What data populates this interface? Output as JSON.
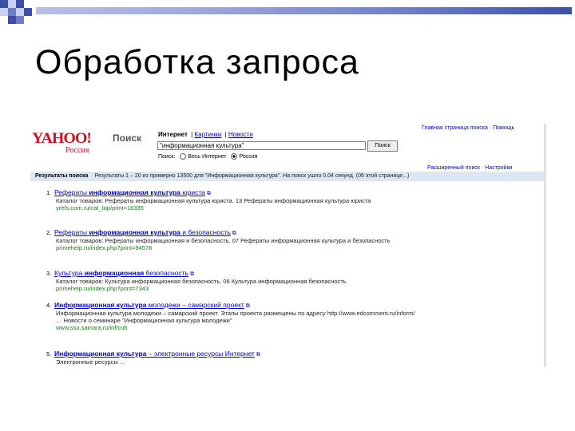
{
  "slide": {
    "title": "Обработка запроса"
  },
  "decor": {
    "accent_dark": "#3e4fa8",
    "accent_light": "#b7bfe6"
  },
  "yahoo": {
    "logo": "YAHOO!",
    "logo_sub": "Россия",
    "search_word": "Поиск",
    "tabs": {
      "internet": "Интернет",
      "images": "Картинки",
      "news": "Новости"
    },
    "query": "\"информационная культура\"",
    "search_button": "Поиск",
    "scope_label": "Поиск:",
    "scope_all": "Весь Интернет",
    "scope_russia": "Россия",
    "top_links": "Главная страница поиска · Помощь",
    "settings_links": "Расширенный поиск · Настройки",
    "results_label": "Результаты поиска",
    "results_stats": "Результаты 1 – 20 из примерно 13500 для \"Информационная культура\". На поиск ушло 0.04 секунд. (06 этой странице...)",
    "results": [
      {
        "num": "1.",
        "title_a": "Рефераты ",
        "title_b": "информационная культура",
        "title_c": " юриста",
        "snippet": "Каталог товаров: Рефераты информационная культура юриста. 13 Рефераты информационная культура юриста",
        "url": "yrefs.com.ru/cat_top/print=16335"
      },
      {
        "num": "2.",
        "title_a": "Рефераты ",
        "title_b": "информационная культура",
        "title_c": " и безопасность",
        "snippet": "Каталог товаров: Рефераты информационная и безопасность. 07 Рефераты информационная культура и безопасность",
        "url": "primehelp.ru/index.php?print=94578"
      },
      {
        "num": "3.",
        "title_a": "Культура ",
        "title_b": "информационная",
        "title_c": " безопасность",
        "snippet": "Каталог товаров: Культура информационная безопасность. 06 Культура информационная безопасность",
        "url": "primehelp.ru/index.php?print=7343"
      },
      {
        "num": "4.",
        "title_a": "",
        "title_b": "Информационная культура",
        "title_c": " молодежи – самарский проект",
        "snippet": "Информационная культура молодежи – самарский проект. Этапы проекта размещены по адресу http://www.edcomment.ru/inform/ … Новости о семинаре \"Информационная культура молодежи\"",
        "url": "www.ssu.samara.ru/inf/cult"
      },
      {
        "num": "5.",
        "title_a": "",
        "title_b": "Информационная культура",
        "title_c": " – электронные ресурсы Интернет",
        "snippet": "Электронные ресурсы …",
        "url": ""
      }
    ]
  }
}
